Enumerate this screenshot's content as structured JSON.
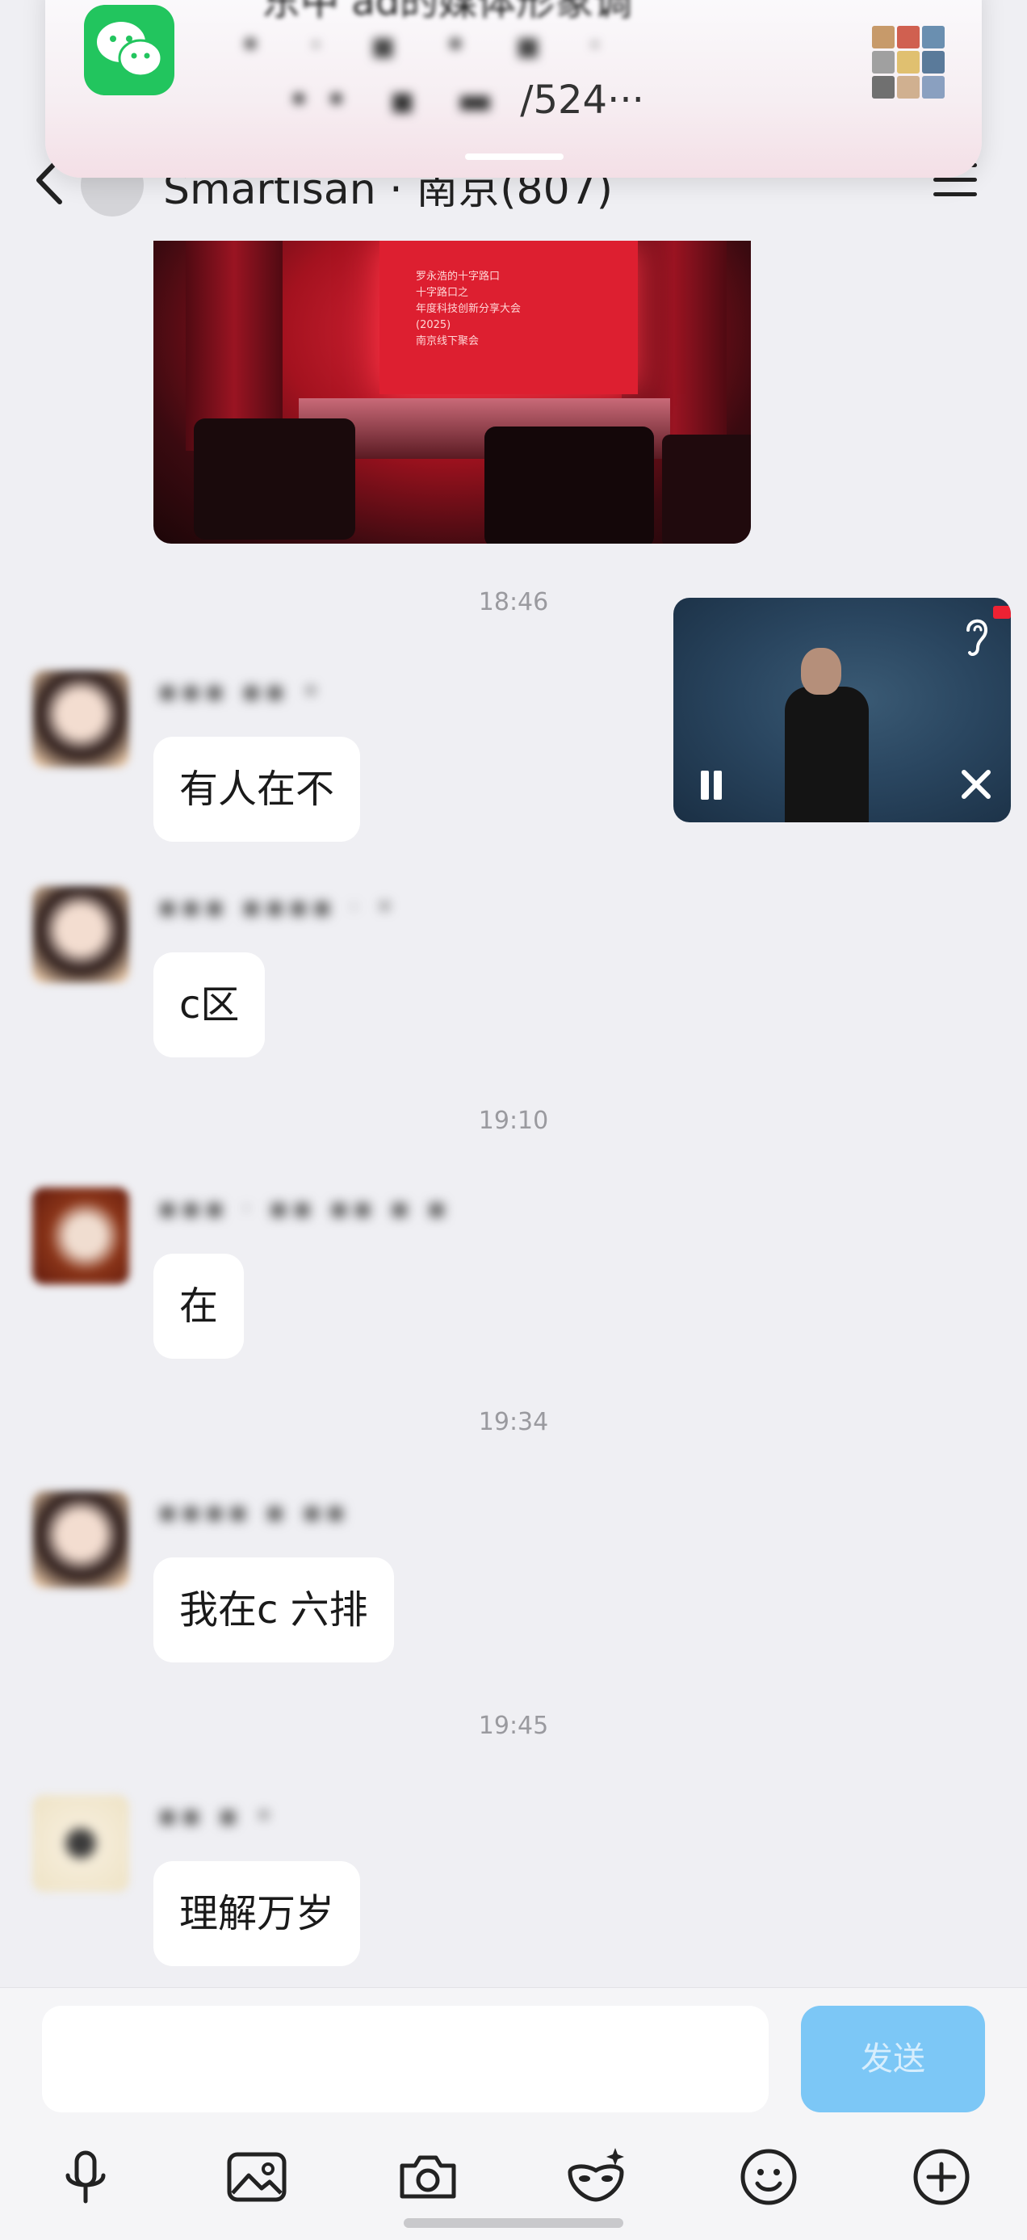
{
  "notification": {
    "app": "WeChat",
    "title_blurred": "东中 ad的媒体形象调",
    "line1_blurred": "•  ·  ▪  •  ▪  ·",
    "line2_prefix_blurred": "•• ▪ ▬",
    "line2_visible": "/524···"
  },
  "header": {
    "title": "Smartisan · 南京(807)"
  },
  "photo": {
    "screen_text": [
      "罗永浩的十字路口",
      "十字路口之",
      "年度科技创新分享大会",
      "(2025)",
      "南京线下聚会"
    ]
  },
  "timestamps": [
    "18:46",
    "19:10",
    "19:34",
    "19:45"
  ],
  "messages": [
    {
      "sender_blurred": "▪▪▪ ▪▪  •",
      "text": "有人在不"
    },
    {
      "sender_blurred": "▪▪▪ ▪▪▪▪ · •",
      "text": "c区"
    },
    {
      "sender_blurred": "▪▪▪ · ▪▪ ▪▪ ▪ ▪",
      "text": "在"
    },
    {
      "sender_blurred": "▪▪▪▪ ▪ ▪▪",
      "text": "我在c 六排"
    },
    {
      "sender_blurred": "▪▪ ▪  •",
      "text": "理解万岁"
    }
  ],
  "floating_video": {
    "state": "playing",
    "controls": [
      "pause-icon",
      "close-icon",
      "ear-icon"
    ]
  },
  "input_bar": {
    "placeholder": "",
    "send_label": "发送",
    "tools": [
      "microphone-icon",
      "image-icon",
      "camera-icon",
      "mask-sparkle-icon",
      "emoji-icon",
      "plus-circle-icon"
    ]
  },
  "colors": {
    "background": "#efeff3",
    "bubble": "#ffffff",
    "send_button": "#7cc7f6",
    "wechat_green": "#22c55e"
  }
}
